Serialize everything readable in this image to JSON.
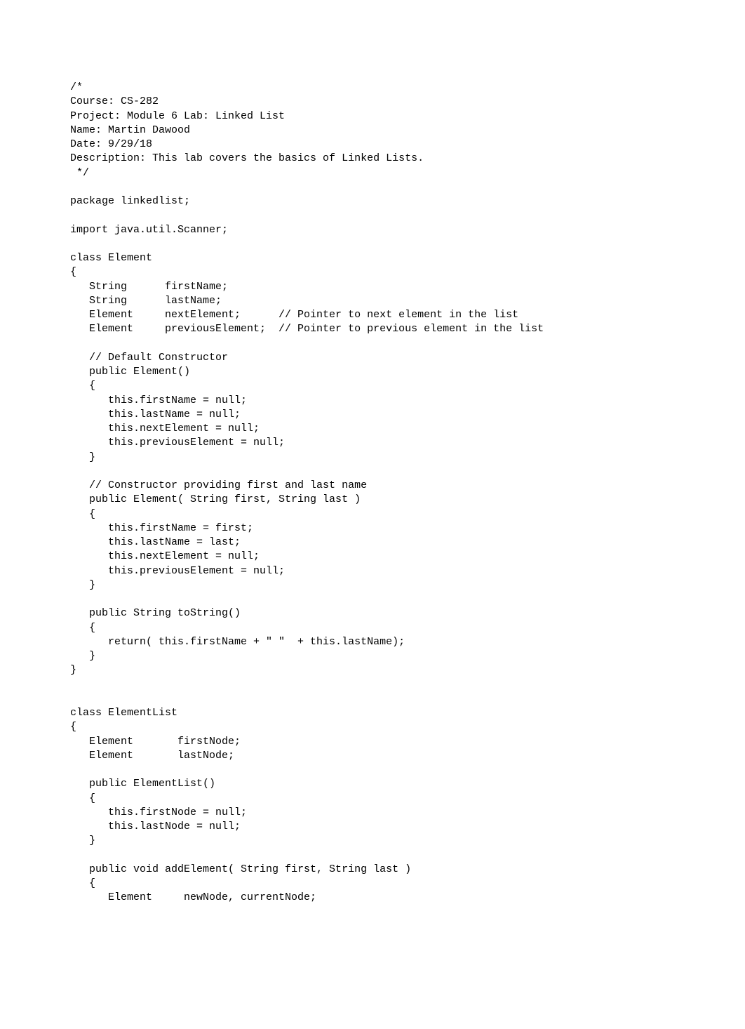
{
  "code": {
    "lines": [
      "/*",
      "Course: CS-282",
      "Project: Module 6 Lab: Linked List",
      "Name: Martin Dawood",
      "Date: 9/29/18",
      "Description: This lab covers the basics of Linked Lists.",
      " */",
      "",
      "package linkedlist;",
      "",
      "import java.util.Scanner;",
      "",
      "class Element",
      "{",
      "   String      firstName;",
      "   String      lastName;",
      "   Element     nextElement;      // Pointer to next element in the list",
      "   Element     previousElement;  // Pointer to previous element in the list",
      "",
      "   // Default Constructor",
      "   public Element()",
      "   {",
      "      this.firstName = null;",
      "      this.lastName = null;",
      "      this.nextElement = null;",
      "      this.previousElement = null;",
      "   }",
      "",
      "   // Constructor providing first and last name",
      "   public Element( String first, String last )",
      "   {",
      "      this.firstName = first;",
      "      this.lastName = last;",
      "      this.nextElement = null;",
      "      this.previousElement = null;",
      "   }",
      "",
      "   public String toString()",
      "   {",
      "      return( this.firstName + \" \"  + this.lastName);",
      "   }",
      "}",
      "",
      "",
      "class ElementList",
      "{",
      "   Element       firstNode;",
      "   Element       lastNode;",
      "",
      "   public ElementList()",
      "   {",
      "      this.firstNode = null;",
      "      this.lastNode = null;",
      "   }",
      "",
      "   public void addElement( String first, String last )",
      "   {",
      "      Element     newNode, currentNode;"
    ]
  }
}
